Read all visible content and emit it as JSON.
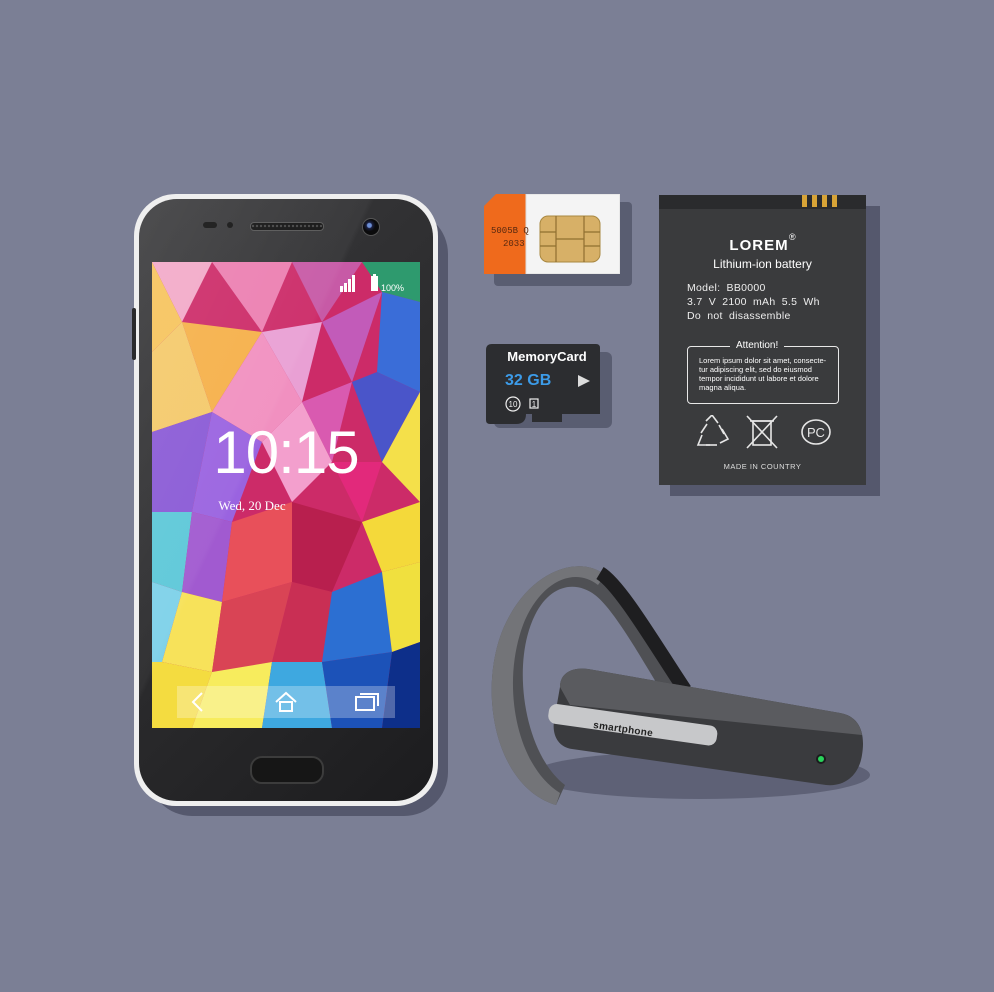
{
  "phone": {
    "time": "10:15",
    "date": "Wed, 20 Dec",
    "battery_percent": "100%",
    "icons": [
      "signal-icon",
      "battery-icon",
      "back-icon",
      "home-icon",
      "recent-apps-icon"
    ]
  },
  "sim_card": {
    "code_line1": "5005B Q",
    "code_line2": "2033"
  },
  "memory_card": {
    "title": "MemoryCard",
    "capacity": "32 GB"
  },
  "battery": {
    "brand": "LOREM",
    "registered": "®",
    "type": "Lithium-ion battery",
    "model": "Model: BB0000",
    "specs": "3.7 V 2100 mAh 5.5 Wh",
    "warning": "Do not disassemble",
    "attention_title": "Attention!",
    "attention_text": "Lorem ipsum dolor sit amet, consecte-tur adipiscing elit, sed do eiusmod tempor incididunt ut labore et dolore magna aliqua.",
    "made_in": "MADE IN COUNTRY"
  },
  "headset": {
    "label": "smartphone"
  }
}
